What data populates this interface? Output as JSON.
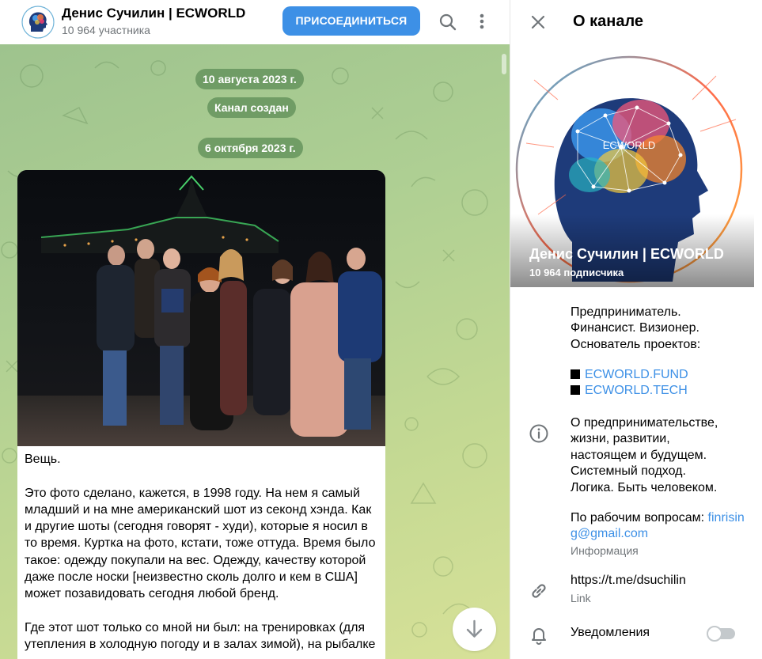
{
  "chat": {
    "title": "Денис Сучилин | ECWORLD",
    "subtitle": "10 964 участника",
    "join_label": "ПРИСОЕДИНИТЬСЯ",
    "dates": [
      "10 августа 2023 г.",
      "Канал создан",
      "6 октября 2023 г."
    ],
    "message": {
      "heading": "Вещь.",
      "paragraph1": "Это фото сделано, кажется, в 1998 году. На нем я самый младший и на мне американский шот из секонд хэнда. Как и другие шоты (сегодня говорят - худи), которые я носил в то время. Куртка на фото, кстати, тоже оттуда. Время было такое: одежду покупали на вес. Одежду, качеству которой даже после носки [неизвестно сколь долго и кем в США] может позавидовать сегодня любой бренд.",
      "paragraph2": "Где этот шот только со мной ни был: на тренировках (для утепления в холодную погоду и в залах зимой), на рыбалке"
    }
  },
  "panel": {
    "title": "О канале",
    "cover_title": "Денис Сучилин | ECWORLD",
    "cover_subtitle": "10 964 подписчика",
    "logo_text": "ECWORLD",
    "bio": [
      "Предприниматель.",
      "Финансист. Визионер.",
      "Основатель проектов:"
    ],
    "links": [
      "ECWORLD.FUND",
      "ECWORLD.TECH"
    ],
    "about": [
      "О предпринимательстве,",
      "жизни, развитии,",
      "настоящем и будущем.",
      "Системный подход.",
      "Логика. Быть человеком."
    ],
    "work_prefix": "По рабочим вопросам: ",
    "work_email": "finrising@gmail.com",
    "info_label": "Информация",
    "link_url": "https://t.me/dsuchilin",
    "link_label": "Link",
    "notifications_label": "Уведомления",
    "notifications_on": false
  },
  "icons": {
    "search": "search-icon",
    "more": "more-vertical-icon",
    "close": "close-icon",
    "info": "info-icon",
    "link": "link-icon",
    "bell": "bell-icon",
    "scroll_down": "arrow-down-icon"
  },
  "colors": {
    "accent": "#3d90e6",
    "date_pill": "#609058",
    "muted_text": "#707579"
  }
}
